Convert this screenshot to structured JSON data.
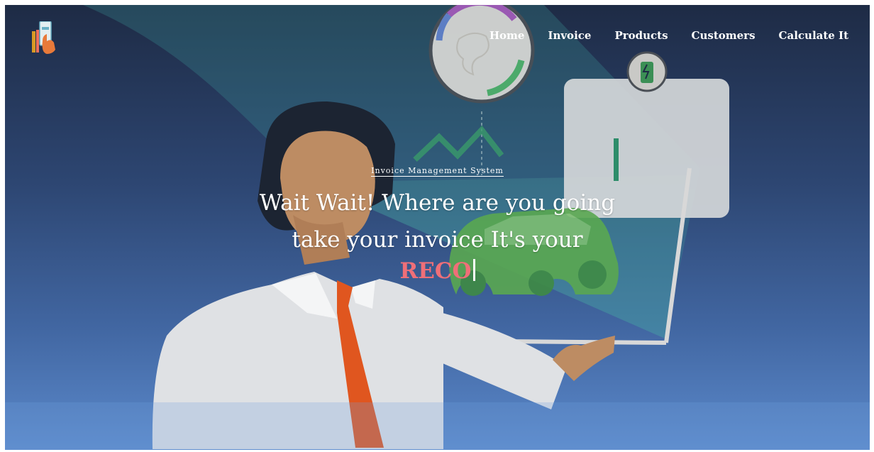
{
  "nav": {
    "items": [
      {
        "label": "Home"
      },
      {
        "label": "Invoice"
      },
      {
        "label": "Products"
      },
      {
        "label": "Customers"
      },
      {
        "label": "Calculate It"
      }
    ]
  },
  "hero": {
    "subtitle": "Invoice Management System",
    "headline_line1": "Wait Wait! Where are you going",
    "headline_line2": "take your invoice It's your",
    "typed_text": "RECO"
  },
  "colors": {
    "background_top": "#1e2b45",
    "background_bottom": "#5b89cb",
    "typed_text": "#ef6f78",
    "tie": "#e0561f",
    "car": "#5aa851"
  }
}
